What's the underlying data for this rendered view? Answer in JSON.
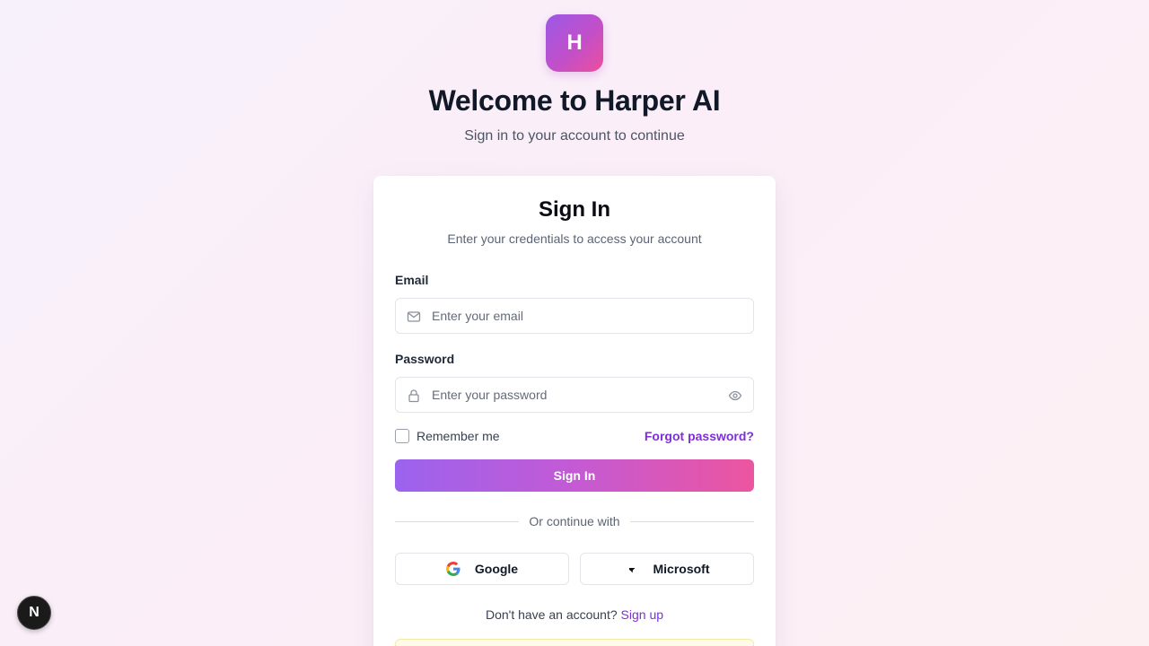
{
  "brand": {
    "logo_letter": "H",
    "welcome_title": "Welcome to Harper AI",
    "welcome_subtitle": "Sign in to your account to continue"
  },
  "card": {
    "title": "Sign In",
    "subtitle": "Enter your credentials to access your account",
    "email": {
      "label": "Email",
      "placeholder": "Enter your email",
      "value": "",
      "icon": "mail-icon"
    },
    "password": {
      "label": "Password",
      "placeholder": "Enter your password",
      "value": "",
      "icon": "lock-icon",
      "toggle_icon": "eye-icon"
    },
    "remember_me": {
      "label": "Remember me",
      "checked": false
    },
    "forgot_password": "Forgot password?",
    "submit_label": "Sign In",
    "divider_text": "Or continue with",
    "sso": {
      "google_label": "Google",
      "microsoft_label": "Microsoft"
    },
    "signup_prompt": "Don't have an account?",
    "signup_link": "Sign up"
  },
  "dev_badge": {
    "letter": "N",
    "icon": "nextjs-icon"
  },
  "colors": {
    "accent": "#7e2fd6",
    "gradient_start": "#9b63ee",
    "gradient_end": "#ec559f",
    "heading": "#111827"
  }
}
